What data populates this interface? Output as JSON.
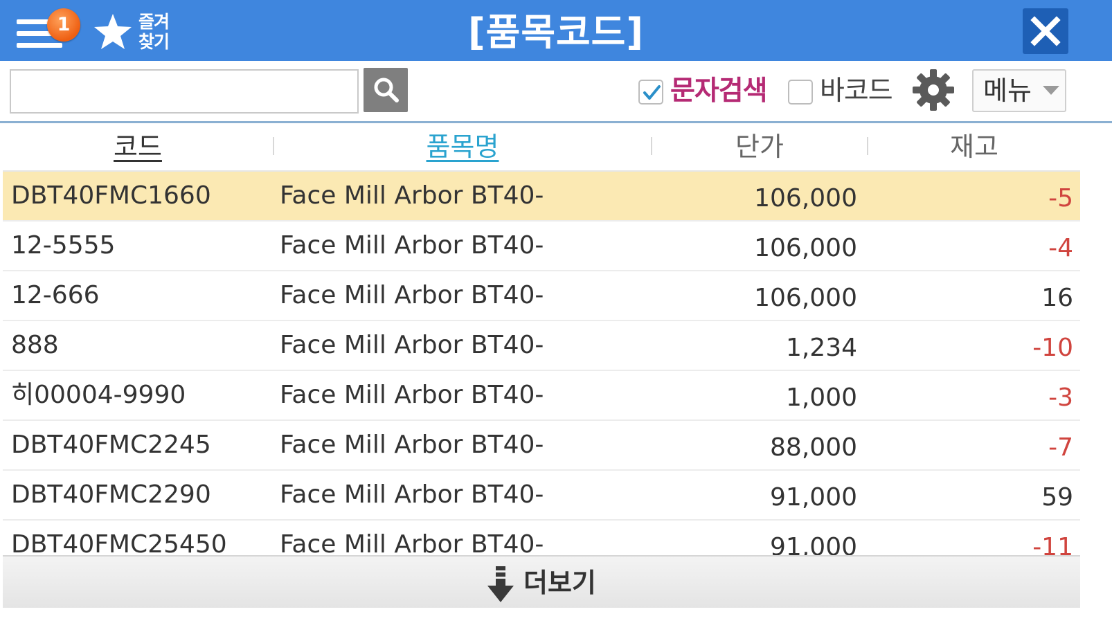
{
  "header": {
    "title": "[품목코드]",
    "notification_count": "1",
    "favorites_label_line1": "즐겨",
    "favorites_label_line2": "찾기"
  },
  "search": {
    "value": "",
    "placeholder": ""
  },
  "options": {
    "text_search_label": "문자검색",
    "text_search_checked": true,
    "barcode_label": "바코드",
    "barcode_checked": false,
    "menu_label": "메뉴"
  },
  "table": {
    "columns": {
      "code": "코드",
      "name": "품목명",
      "price": "단가",
      "stock": "재고"
    },
    "rows": [
      {
        "code": "DBT40FMC1660",
        "name": "Face Mill Arbor BT40-",
        "price": "106,000",
        "stock": "-5"
      },
      {
        "code": "12-5555",
        "name": "Face Mill Arbor BT40-",
        "price": "106,000",
        "stock": "-4"
      },
      {
        "code": "12-666",
        "name": "Face Mill Arbor BT40-",
        "price": "106,000",
        "stock": "16"
      },
      {
        "code": "888",
        "name": "Face Mill Arbor BT40-",
        "price": "1,234",
        "stock": "-10"
      },
      {
        "code": "히00004-9990",
        "name": "Face Mill Arbor BT40-",
        "price": "1,000",
        "stock": "-3"
      },
      {
        "code": "DBT40FMC2245",
        "name": "Face Mill Arbor BT40-",
        "price": "88,000",
        "stock": "-7"
      },
      {
        "code": "DBT40FMC2290",
        "name": "Face Mill Arbor BT40-",
        "price": "91,000",
        "stock": "59"
      },
      {
        "code": "DBT40FMC25450",
        "name": "Face Mill Arbor BT40-",
        "price": "91,000",
        "stock": "-11"
      }
    ]
  },
  "footer": {
    "more_label": "더보기"
  },
  "colors": {
    "titlebar": "#3f86de",
    "close_button": "#1e5fb5",
    "badge": "#ee5f12",
    "selected_row": "#fbe9b3",
    "negative_stock": "#d0443e",
    "sort_column": "#2aa3cf",
    "text_search_label": "#b52a74"
  },
  "icons": [
    "hamburger-icon",
    "star-icon",
    "close-icon",
    "search-icon",
    "checkmark-icon",
    "gear-icon",
    "chevron-down-icon",
    "arrow-down-icon"
  ]
}
